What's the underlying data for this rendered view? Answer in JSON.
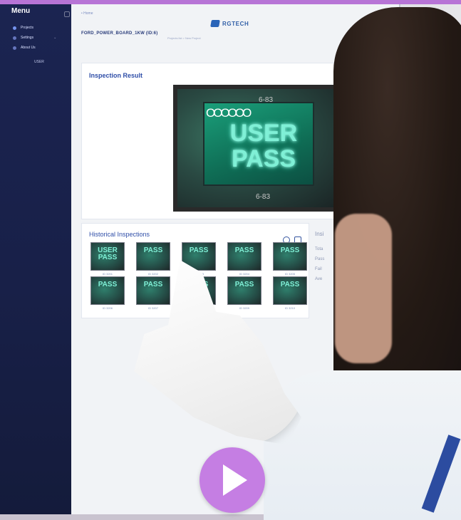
{
  "sidebar": {
    "title": "Menu",
    "items": [
      {
        "label": "Projects",
        "active": true
      },
      {
        "label": "Settings",
        "active": false
      },
      {
        "label": "About Us",
        "active": false
      }
    ],
    "user": "USER"
  },
  "header": {
    "home": "Home",
    "project_title": "FORD_POWER_BOARD_1KW (ID:6)",
    "crumbs": "Projects list > New Project",
    "brand": "RGTECH"
  },
  "inspection_result": {
    "title": "Inspection Result",
    "status": "USER\nPASS",
    "rings": "OOOOOO",
    "board_label": "6-83"
  },
  "history": {
    "title": "Historical Inspections",
    "items": [
      {
        "status": "USER PASS",
        "caption": "ID 3201"
      },
      {
        "status": "PASS",
        "caption": "ID 3202"
      },
      {
        "status": "PASS",
        "caption": "ID 3203"
      },
      {
        "status": "PASS",
        "caption": "ID 3204"
      },
      {
        "status": "PASS",
        "caption": "ID 3205"
      },
      {
        "status": "PASS",
        "caption": "ID 3206"
      },
      {
        "status": "PASS",
        "caption": "ID 3207"
      },
      {
        "status": "PASS",
        "caption": "ID 3208"
      },
      {
        "status": "PASS",
        "caption": "ID 3209"
      },
      {
        "status": "PASS",
        "caption": "ID 3210"
      }
    ]
  },
  "info_panel": {
    "title": "Insi",
    "rows": [
      "Tota",
      "Pass",
      "Fail",
      "Ave"
    ]
  },
  "colors": {
    "accent_purple": "#b774d6",
    "sidebar": "#1b2451",
    "primary_blue": "#2f4ea8",
    "pass_glow": "#7ff0d6"
  },
  "icons": [
    "refresh-icon",
    "camera-icon",
    "chevron-left-icon",
    "chevron-right-icon",
    "play-icon"
  ]
}
